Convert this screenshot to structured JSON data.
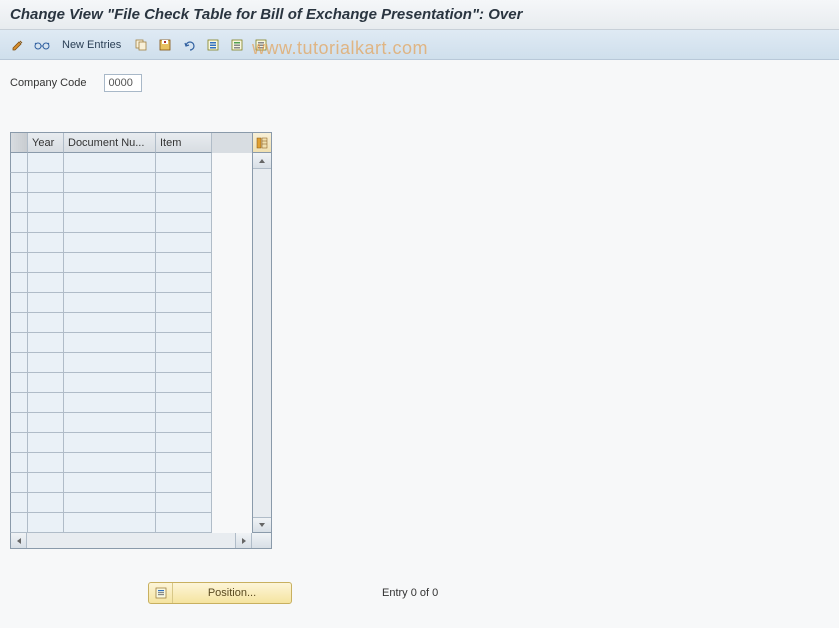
{
  "title": "Change View \"File Check Table for Bill of Exchange Presentation\": Over",
  "toolbar": {
    "new_entries_label": "New Entries"
  },
  "fields": {
    "company_code_label": "Company Code",
    "company_code_value": "0000"
  },
  "grid": {
    "columns": {
      "selector": "",
      "year": "Year",
      "doc": "Document Nu...",
      "item": "Item"
    },
    "row_count": 19
  },
  "footer": {
    "position_label": "Position...",
    "entry_status": "Entry 0 of 0"
  },
  "watermark": "www.tutorialkart.com"
}
